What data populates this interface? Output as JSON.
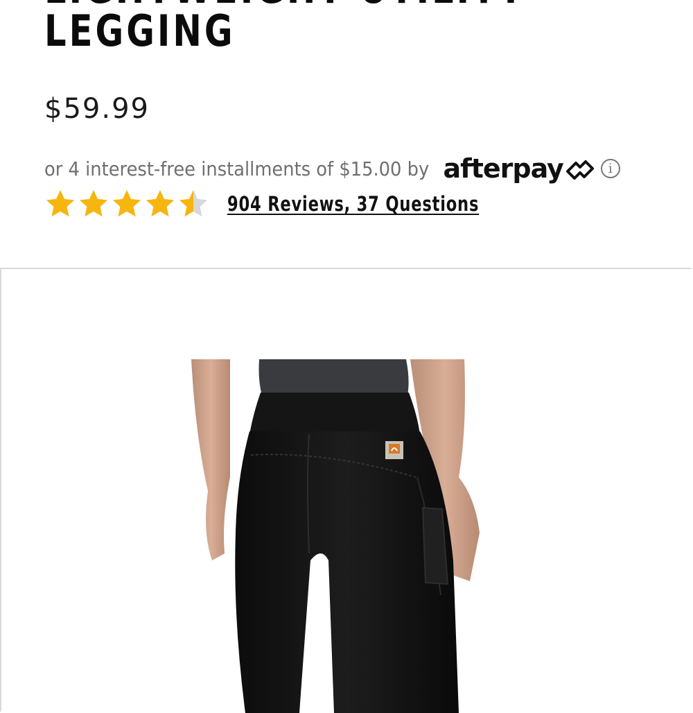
{
  "product": {
    "title_line1": "LIGHTWEIGHT UTILITY",
    "title_line2": "LEGGING",
    "price": "$59.99"
  },
  "afterpay": {
    "text": "or 4 interest-free installments of $15.00 by",
    "logo_text": "afterpay",
    "info_icon": "info-icon"
  },
  "rating": {
    "stars": 4.5,
    "max_stars": 5,
    "reviews_link": "904 Reviews, 37 Questions",
    "star_color": "#f6b60f",
    "empty_star_color": "#d8d8d8"
  },
  "image": {
    "logo_patch": "Carhartt patch"
  }
}
